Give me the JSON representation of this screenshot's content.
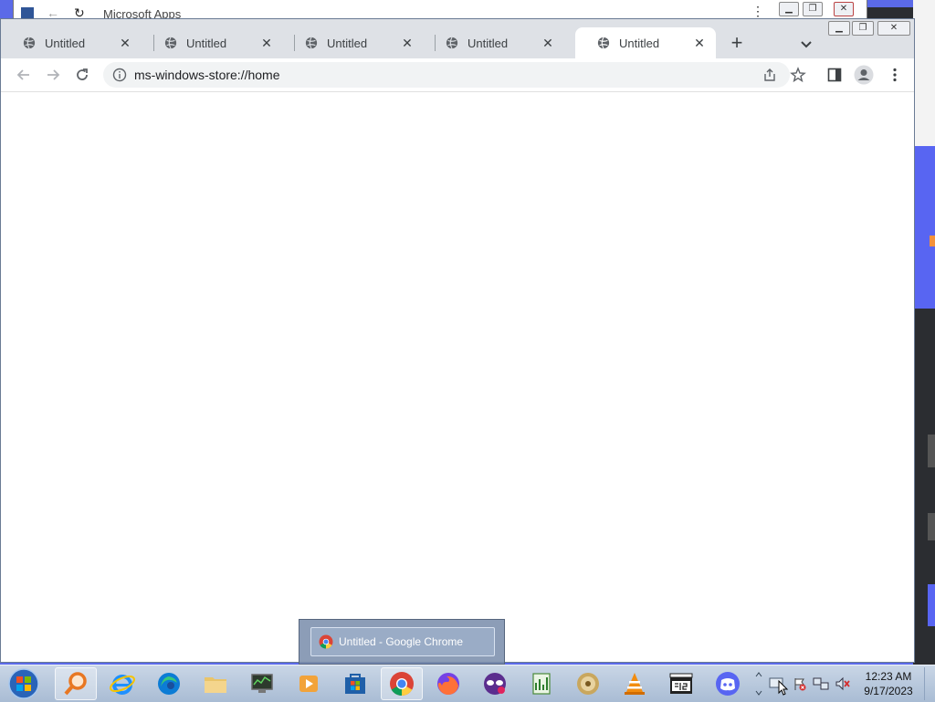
{
  "background_window": {
    "title": "Microsoft Apps"
  },
  "browser": {
    "tabs": [
      {
        "label": "Untitled",
        "active": false
      },
      {
        "label": "Untitled",
        "active": false
      },
      {
        "label": "Untitled",
        "active": false
      },
      {
        "label": "Untitled",
        "active": false
      },
      {
        "label": "Untitled",
        "active": true
      }
    ],
    "new_tab_symbol": "+",
    "address": "ms-windows-store://home",
    "icons": [
      "back-icon",
      "forward-icon",
      "reload-icon",
      "info-icon",
      "share-icon",
      "star-icon",
      "side-panel-icon",
      "profile-icon",
      "menu-icon",
      "tab-search-icon"
    ]
  },
  "taskbar": {
    "apps": [
      "search-everything-app",
      "internet-explorer-app",
      "edge-app",
      "file-explorer-app",
      "system-monitor-app",
      "media-player-app",
      "microsoft-store-app",
      "chrome-app",
      "firefox-app",
      "mask-app",
      "spreadsheet-app",
      "disc-burner-app",
      "vlc-app",
      "video-counter-app",
      "discord-app"
    ],
    "preview_item": "Untitled - Google Chrome",
    "clock_time": "12:23 AM",
    "clock_date": "9/17/2023"
  },
  "colors": {
    "chrome_tabstrip": "#dee1e6",
    "taskbar": "#b8c8dc",
    "accent": "#5865f2"
  }
}
